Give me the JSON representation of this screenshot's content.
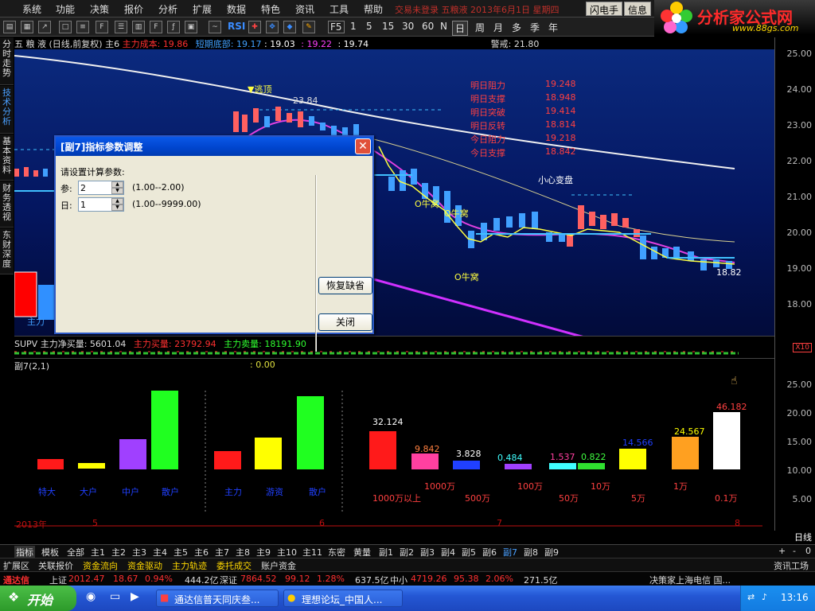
{
  "menu": {
    "items": [
      "系统",
      "功能",
      "决策",
      "报价",
      "分析",
      "扩展",
      "数据",
      "特色",
      "资讯",
      "工具",
      "帮助"
    ],
    "ticker_text": "交易未登录 五粮液 2013年6月1日 星期四",
    "buttons": [
      "闪电手",
      "信息"
    ]
  },
  "logo": {
    "title": "分析家公式网",
    "url": "www.88gs.com"
  },
  "toolbar": {
    "rsi": "RSI",
    "periods": [
      "F5",
      "1",
      "5",
      "15",
      "30",
      "60",
      "N",
      "日",
      "周",
      "月",
      "多",
      "季",
      "年"
    ]
  },
  "left_tabs": [
    "分时走势",
    "技术分析",
    "基本资料",
    "财务透视",
    "东财深度"
  ],
  "main_info": {
    "title": "五 粮 液 (日线,前复权) 主6",
    "cost_label": "主力成本:",
    "cost_value": "19.86",
    "bottom_label": "短期底部:",
    "bottom_values": [
      "19.17",
      "19.03",
      "19.22",
      "19.74"
    ],
    "alert": "警戒: 21.80"
  },
  "y_axis": [
    "25.00",
    "24.00",
    "23.00",
    "22.00",
    "21.00",
    "20.00",
    "19.00",
    "18.00"
  ],
  "annotations": {
    "escape": "▼逃顶",
    "high": "23.84",
    "careful": "小心变盘",
    "nest1": "O牛窝",
    "nest2": "O牛窝",
    "nest3": "O牛窝",
    "low": "18.82",
    "main_label": "主力",
    "levels": [
      {
        "label": "明日阻力",
        "value": "19.248"
      },
      {
        "label": "明日支撑",
        "value": "18.948"
      },
      {
        "label": "明日突破",
        "value": "19.414"
      },
      {
        "label": "明日反转",
        "value": "18.814"
      },
      {
        "label": "今日阻力",
        "value": "19.218"
      },
      {
        "label": "今日支撑",
        "value": "18.842"
      }
    ]
  },
  "supv": {
    "text": "SUPV 主力净买量: 5601.04",
    "buy_label": "主力买量:",
    "buy_value": "23792.94",
    "sell_label": "主力卖量:",
    "sell_value": "18191.90",
    "x10": "X10"
  },
  "sub7": {
    "title": "副7(2,1)",
    "value": ": 0.00",
    "y_axis": [
      "25.00",
      "20.00",
      "15.00",
      "10.00",
      "5.00"
    ],
    "group1": [
      "特大",
      "大户",
      "中户",
      "散户"
    ],
    "group2": [
      "主力",
      "游资",
      "散户"
    ],
    "group3_values": [
      "32.124",
      "9.842",
      "3.828",
      "0.484",
      "1.537",
      "0.822",
      "14.566",
      "24.567",
      "46.182"
    ],
    "group3_labels_top": [
      "1000万",
      "100万",
      "10万",
      "1万"
    ],
    "group3_labels_bottom": [
      "1000万以上",
      "500万",
      "50万",
      "5万",
      "0.1万"
    ],
    "months": [
      "2013年",
      "5",
      "6",
      "7",
      "8"
    ]
  },
  "axis_label": "日线",
  "tabs": {
    "items": [
      "指标",
      "模板",
      "全部",
      "主1",
      "主2",
      "主3",
      "主4",
      "主5",
      "主6",
      "主7",
      "主8",
      "主9",
      "主10",
      "主11",
      "东密",
      "黄量",
      "副1",
      "副2",
      "副3",
      "副4",
      "副5",
      "副6",
      "副7",
      "副8",
      "副9"
    ],
    "active": "副7",
    "controls": [
      "+",
      "-",
      "0"
    ]
  },
  "func_tabs": [
    "扩展区",
    "关联报价",
    "资金流向",
    "资金驱动",
    "主力轨迹",
    "委托成交",
    "账户资金"
  ],
  "func_tab_right": "资讯工场",
  "market": {
    "brand": "通达信",
    "sh_label": "上证",
    "sh_index": "2012.47",
    "sh_change": "18.67",
    "sh_pct": "0.94%",
    "sh_amount": "444.2亿",
    "sz_label": "深证",
    "sz_index": "7864.52",
    "sz_change": "99.12",
    "sz_pct": "1.28%",
    "sz_amount": "637.5亿",
    "zx_label": "中小",
    "zx_index": "4719.26",
    "zx_change": "95.38",
    "zx_pct": "2.06%",
    "zx_amount": "271.5亿",
    "right_text": "决策家上海电信 国..."
  },
  "dialog": {
    "title": "[副7]指标参数调整",
    "prompt": "请设置计算参数:",
    "param1_label": "参:",
    "param1_value": "2",
    "param1_range": "(1.00--2.00)",
    "param2_label": "日:",
    "param2_value": "1",
    "param2_range": "(1.00--9999.00)",
    "restore_button": "恢复缺省",
    "close_button": "关闭"
  },
  "taskbar": {
    "start": "开始",
    "tasks": [
      "通达信普天同庆叁...",
      "理想论坛_中国人..."
    ],
    "clock": "13:16"
  }
}
